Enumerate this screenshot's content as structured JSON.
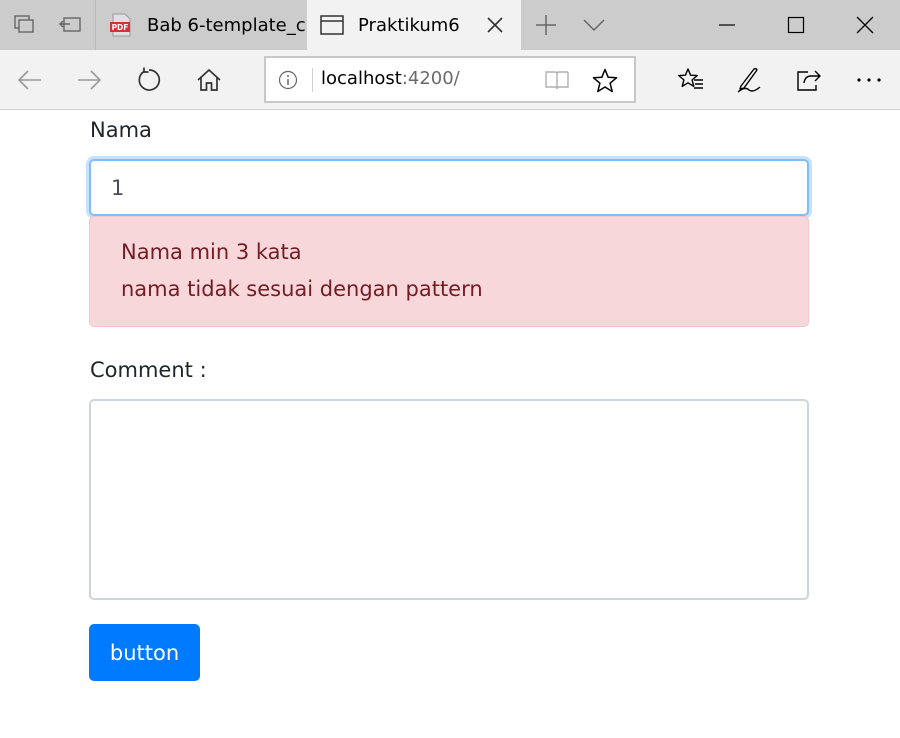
{
  "browser": {
    "tabs": [
      {
        "title": "Bab 6-template_c",
        "icon": "pdf-icon",
        "active": false
      },
      {
        "title": "Praktikum6",
        "icon": "page-icon",
        "active": true
      }
    ],
    "pdf_badge": "PDF",
    "address": {
      "host": "localhost",
      "port_path": ":4200/"
    }
  },
  "form": {
    "nama_label": "Nama",
    "nama_value": "1",
    "errors": [
      "Nama min 3 kata",
      "nama tidak sesuai dengan pattern"
    ],
    "comment_label": "Comment :",
    "comment_value": "",
    "button_label": "button"
  },
  "colors": {
    "accent": "#007bff",
    "error_bg": "#f8d7da",
    "error_text": "#721c24",
    "focus_border": "#80bdff"
  }
}
